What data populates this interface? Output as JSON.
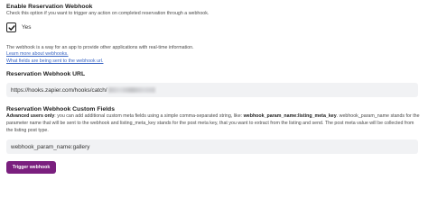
{
  "enable": {
    "title": "Enable Reservation Webhook",
    "help": "Check this option if you want to trigger any action on completed reservation through a webhook.",
    "checkbox_checked": true,
    "checkbox_label": "Yes"
  },
  "description": {
    "text": "The webhook is a way for an app to provide other applications with real-time information.",
    "link_learn_more": "Learn more about webhooks.",
    "link_fields": "What fields are being sent to the webhook url."
  },
  "url": {
    "title": "Reservation Webhook URL",
    "value_visible": "https://hooks.zapier.com/hooks/catch/"
  },
  "custom_fields": {
    "title": "Reservation Webhook Custom Fields",
    "help_prefix": "Advanced users only",
    "help_part1": ": you can add additional custom meta fields using a simple comma-separated string, like: ",
    "help_example": "webhook_param_name:listing_meta_key",
    "help_part2": ". webhook_param_name stands for the parameter name that will be sent to the webhook and listing_meta_key stands for the post meta key, that you want to extract from the listing and send. The post meta value will be collected from the listing post type.",
    "value": "webhook_param_name:gallery"
  },
  "trigger_button": {
    "label": "Trigger webhook",
    "color": "#7a1f7e"
  }
}
